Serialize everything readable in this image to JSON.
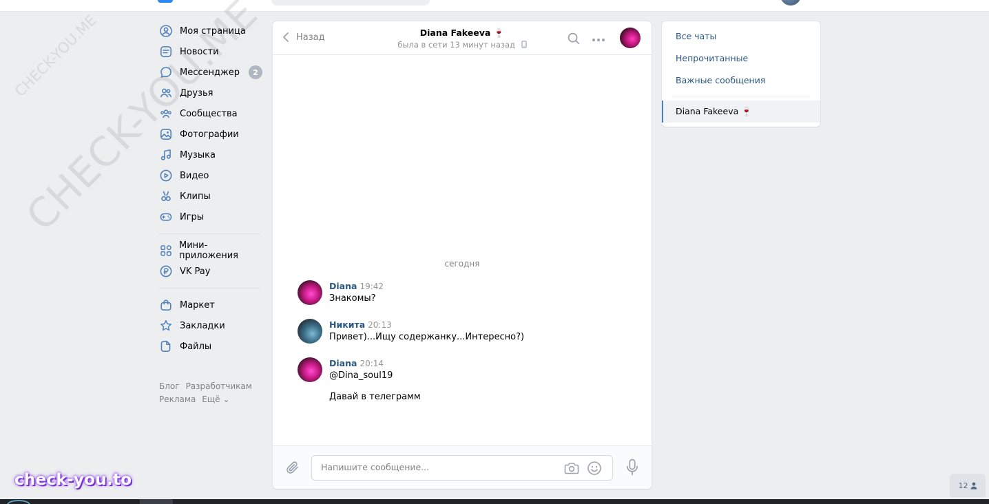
{
  "nav": {
    "items": [
      {
        "label": "Моя страница",
        "icon": "user-circle-icon"
      },
      {
        "label": "Новости",
        "icon": "news-icon"
      },
      {
        "label": "Мессенджер",
        "icon": "message-icon",
        "badge": "2"
      },
      {
        "label": "Друзья",
        "icon": "friends-icon"
      },
      {
        "label": "Сообщества",
        "icon": "communities-icon"
      },
      {
        "label": "Фотографии",
        "icon": "photo-icon"
      },
      {
        "label": "Музыка",
        "icon": "music-icon"
      },
      {
        "label": "Видео",
        "icon": "video-icon"
      },
      {
        "label": "Клипы",
        "icon": "clips-icon"
      },
      {
        "label": "Игры",
        "icon": "gamepad-icon"
      }
    ],
    "items2": [
      {
        "label": "Мини-приложения",
        "icon": "apps-icon"
      },
      {
        "label": "VK Pay",
        "icon": "vkpay-icon"
      }
    ],
    "items3": [
      {
        "label": "Маркет",
        "icon": "bag-icon"
      },
      {
        "label": "Закладки",
        "icon": "star-icon"
      },
      {
        "label": "Файлы",
        "icon": "file-icon"
      }
    ],
    "footer": {
      "blog": "Блог",
      "developers": "Разработчикам",
      "ads": "Реклама",
      "more": "Ещё ⌄"
    }
  },
  "chat": {
    "back_label": "Назад",
    "peer_name": "Diana Fakeeva 🍷",
    "peer_status": "была в сети 13 минут назад",
    "day_separator": "сегодня",
    "messages": [
      {
        "author": "Diana",
        "time": "19:42",
        "lines": [
          "Знакомы?"
        ]
      },
      {
        "author": "Никита",
        "time": "20:13",
        "lines": [
          "Привет)...Ищу содержанку...Интересно?)"
        ]
      },
      {
        "author": "Diana",
        "time": "20:14",
        "lines": [
          "@Dina_soul19",
          "Давай в телеграмм"
        ]
      }
    ],
    "composer_placeholder": "Напишите сообщение..."
  },
  "right_panel": {
    "all_chats": "Все чаты",
    "unread": "Непрочитанные",
    "important": "Важные сообщения",
    "active_chat": "Diana Fakeeva 🍷"
  },
  "watermark": {
    "big": "CHECK-YOU.ME",
    "small": "CHECK-YOU.ME",
    "brand": "check-you.to"
  },
  "online_counter": "12",
  "colors": {
    "background": "#edeef0",
    "link": "#2a5885",
    "icon_blue": "#5181b8",
    "badge": "#aeb7c2",
    "muted": "#828282"
  }
}
